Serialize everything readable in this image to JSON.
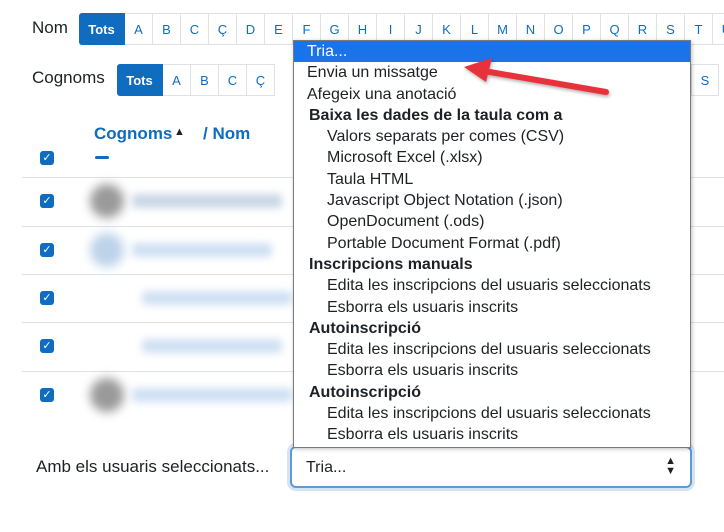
{
  "filters": {
    "first_name": {
      "label": "Nom",
      "all_label": "Tots",
      "letters": [
        "A",
        "B",
        "C",
        "Ç",
        "D",
        "E",
        "F",
        "G",
        "H",
        "I",
        "J",
        "K",
        "L",
        "M",
        "N",
        "O",
        "P",
        "Q",
        "R",
        "S",
        "T",
        "U"
      ]
    },
    "last_name": {
      "label": "Cognoms",
      "all_label": "Tots",
      "letters": [
        "A",
        "B",
        "C",
        "Ç"
      ],
      "trailing_letter": "S"
    }
  },
  "table": {
    "header_lastname": "Cognoms",
    "header_separator": "/",
    "header_firstname": "Nom",
    "sort_icon": "caret-up-icon",
    "header_checkbox_checked": true,
    "rows_checked": [
      true,
      true,
      true,
      true,
      true
    ]
  },
  "bulk_action": {
    "label": "Amb els usuaris seleccionats...",
    "select_value": "Tria...",
    "options": {
      "selected": "Tria...",
      "send_message": "Envia un missatge",
      "add_note": "Afegeix una anotació",
      "download_group": "Baixa les dades de la taula com a",
      "download_formats": [
        "Valors separats per comes (CSV)",
        "Microsoft Excel (.xlsx)",
        "Taula HTML",
        "Javascript Object Notation (.json)",
        "OpenDocument (.ods)",
        "Portable Document Format (.pdf)"
      ],
      "groups": [
        {
          "label": "Inscripcions manuals",
          "items": [
            "Edita les inscripcions del usuaris seleccionats",
            "Esborra els usuaris inscrits"
          ]
        },
        {
          "label": "Autoinscripció",
          "items": [
            "Edita les inscripcions del usuaris seleccionats",
            "Esborra els usuaris inscrits"
          ]
        },
        {
          "label": "Autoinscripció",
          "items": [
            "Edita les inscripcions del usuaris seleccionats",
            "Esborra els usuaris inscrits"
          ]
        }
      ]
    }
  },
  "colors": {
    "accent": "#0f6cbf",
    "selected_option": "#1a73e8",
    "annotation_arrow": "#e8333b"
  }
}
